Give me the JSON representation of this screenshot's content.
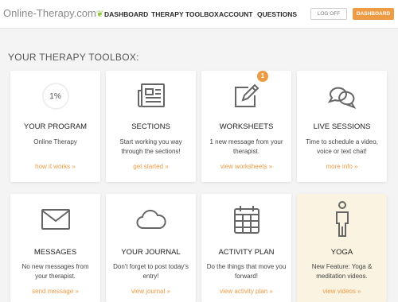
{
  "header": {
    "logo_text": "Online-Therapy.com",
    "nav": [
      "DASHBOARD",
      "THERAPY TOOLBOX",
      "ACCOUNT",
      "QUESTIONS"
    ],
    "logoff_label": "LOG OFF",
    "dashboard_label": "DASHBOARD"
  },
  "toolbox": {
    "title": "YOUR THERAPY TOOLBOX:",
    "cards": [
      {
        "title": "YOUR PROGRAM",
        "desc": "Online Therapy",
        "link": "how it works »",
        "progress": "1%",
        "icon": "progress-icon"
      },
      {
        "title": "SECTIONS",
        "desc": "Start working you way through the sections!",
        "link": "get started »",
        "icon": "newspaper-icon"
      },
      {
        "title": "WORKSHEETS",
        "desc": "1 new message from your therapist.",
        "link": "view worksheets »",
        "badge": "1",
        "icon": "pencil-square-icon"
      },
      {
        "title": "LIVE SESSIONS",
        "desc": "Time to schedule a video, voice or text chat!",
        "link": "more info »",
        "icon": "chat-bubbles-icon"
      },
      {
        "title": "MESSAGES",
        "desc": "No new messages from your therapist.",
        "link": "send message »",
        "icon": "envelope-icon"
      },
      {
        "title": "YOUR JOURNAL",
        "desc": "Don't forget to post today's entry!",
        "link": "view journal »",
        "icon": "cloud-icon"
      },
      {
        "title": "ACTIVITY PLAN",
        "desc": "Do the things that move you forward!",
        "link": "view activity plan »",
        "icon": "calendar-icon"
      },
      {
        "title": "YOGA",
        "desc": "New Feature: Yoga & meditation videos.",
        "link": "view videos »",
        "icon": "person-icon"
      }
    ]
  },
  "colors": {
    "accent": "#ee9b45",
    "logo_leaf": "#8cc63f",
    "highlight_card": "#fbf3e1"
  }
}
